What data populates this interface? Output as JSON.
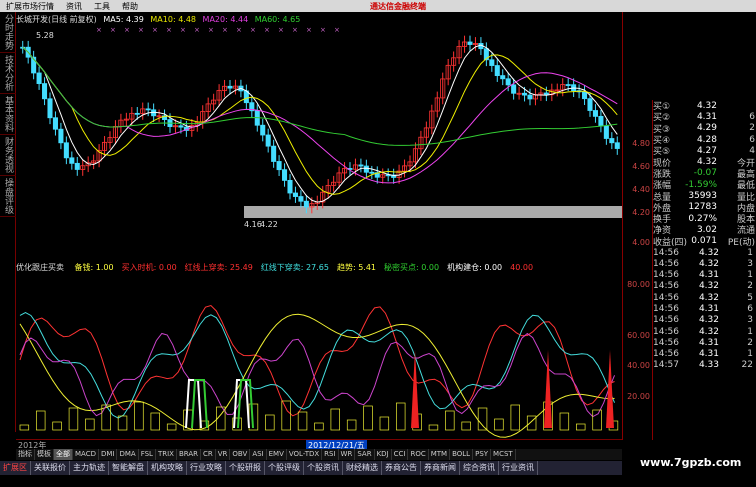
{
  "menu": {
    "items": [
      "扩展市场行情",
      "资讯",
      "工具",
      "帮助"
    ],
    "promo": "通达信金融终端"
  },
  "left_tabs": [
    "分时走势",
    "技术分析",
    "基本资料",
    "财务透视",
    "操盘评级"
  ],
  "chart": {
    "title": "长城开发(日线 前复权)",
    "ma": [
      {
        "label": "MA5: 4.39",
        "color": "#ffffff"
      },
      {
        "label": "MA10: 4.48",
        "color": "#e8e800"
      },
      {
        "label": "MA20: 4.44",
        "color": "#e040e0"
      },
      {
        "label": "MA60: 4.65",
        "color": "#30d030"
      }
    ],
    "high_label": "5.28",
    "low_label": "4.16",
    "low_label2": "4.22",
    "y_ticks": [
      "4.80",
      "4.60",
      "4.40",
      "4.20",
      "4.00"
    ],
    "indicator_ticks": [
      "80.00",
      "60.00",
      "40.00",
      "20.00"
    ]
  },
  "indicator": {
    "name": "优化跟庄买卖",
    "items": [
      {
        "label": "备钱: 1.00",
        "color": "#ffff40"
      },
      {
        "label": "买入时机: 0.00",
        "color": "#ff3030"
      },
      {
        "label": "红线上穿卖: 25.49",
        "color": "#ff3030"
      },
      {
        "label": "红线下穿卖: 27.65",
        "color": "#40e0e0"
      },
      {
        "label": "趋势: 5.41",
        "color": "#ffff40"
      },
      {
        "label": "秘密买点: 0.00",
        "color": "#30d030"
      },
      {
        "label": "机构建仓: 0.00",
        "color": "#ffffff"
      },
      {
        "label": "40.00",
        "color": "#ff3030"
      }
    ]
  },
  "quote": [
    {
      "k": "买②",
      "v": "4.31",
      "x": "6"
    },
    {
      "k": "买③",
      "v": "4.29",
      "x": "2"
    },
    {
      "k": "买④",
      "v": "4.28",
      "x": "6"
    },
    {
      "k": "买⑤",
      "v": "4.27",
      "x": "4"
    },
    {
      "k": "现价",
      "v": "4.32",
      "x": "今开"
    },
    {
      "k": "涨跌",
      "v": "-0.07",
      "x": "最高"
    },
    {
      "k": "涨幅",
      "v": "-1.59%",
      "x": "最低"
    },
    {
      "k": "总量",
      "v": "35993",
      "x": "量比"
    },
    {
      "k": "外盘",
      "v": "12783",
      "x": "内盘"
    },
    {
      "k": "换手",
      "v": "0.27%",
      "x": "股本"
    },
    {
      "k": "净资",
      "v": "3.02",
      "x": "流通"
    },
    {
      "k": "收益(四)",
      "v": "0.071",
      "x": "PE(动)"
    }
  ],
  "quote_top": {
    "k": "买①",
    "v": "4.32"
  },
  "ticks": [
    {
      "t": "14:56",
      "p": "4.32",
      "n": "1"
    },
    {
      "t": "14:56",
      "p": "4.32",
      "n": "3"
    },
    {
      "t": "14:56",
      "p": "4.31",
      "n": "1"
    },
    {
      "t": "14:56",
      "p": "4.32",
      "n": "2"
    },
    {
      "t": "14:56",
      "p": "4.32",
      "n": "5"
    },
    {
      "t": "14:56",
      "p": "4.31",
      "n": "6"
    },
    {
      "t": "14:56",
      "p": "4.32",
      "n": "3"
    },
    {
      "t": "14:56",
      "p": "4.32",
      "n": "1"
    },
    {
      "t": "14:56",
      "p": "4.31",
      "n": "2"
    },
    {
      "t": "14:56",
      "p": "4.31",
      "n": "1"
    },
    {
      "t": "14:57",
      "p": "4.33",
      "n": "22"
    }
  ],
  "date_axis": {
    "year": "2012年",
    "highlight": "2012/12/21/五"
  },
  "toolbar": [
    "指标",
    "模板",
    "全部",
    "MACD",
    "DMI",
    "DMA",
    "FSL",
    "TRIX",
    "BRAR",
    "CR",
    "VR",
    "OBV",
    "ASI",
    "EMV",
    "VOL-TDX",
    "RSI",
    "WR",
    "SAR",
    "KDJ",
    "CCI",
    "ROC",
    "MTM",
    "BOLL",
    "PSY",
    "MCST"
  ],
  "tabs": [
    "扩展区",
    "关联报价",
    "主力轨迹",
    "智能解盘",
    "机构攻略",
    "行业攻略",
    "个股研报",
    "个股评级",
    "个股资讯",
    "财经精选",
    "券商公告",
    "券商新闻",
    "综合资讯",
    "行业资讯"
  ],
  "watermark": "www.7gpzb.com"
}
